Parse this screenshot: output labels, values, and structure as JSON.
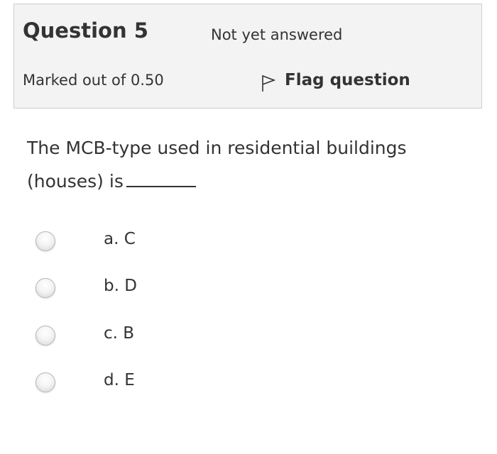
{
  "info": {
    "title": "Question 5",
    "state": "Not yet answered",
    "grade": "Marked out of 0.50",
    "flag_label": "Flag question",
    "flag_icon": "flag-outline-icon"
  },
  "question": {
    "text": "The MCB-type used in residential buildings (houses) is"
  },
  "answers": [
    {
      "label": "a. C",
      "selected": false
    },
    {
      "label": "b. D",
      "selected": false
    },
    {
      "label": "c. B",
      "selected": false
    },
    {
      "label": "d. E",
      "selected": false
    }
  ]
}
